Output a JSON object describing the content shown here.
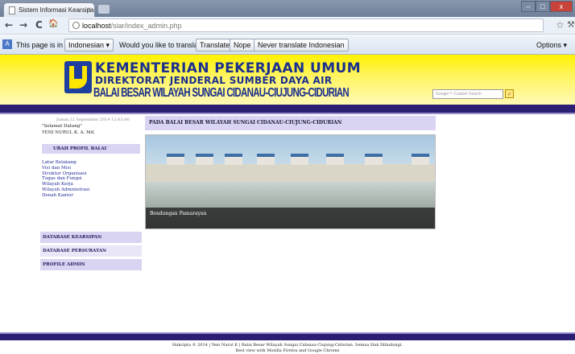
{
  "browser": {
    "tab_title": "Sistem Informasi Kearsipan",
    "tab_close": "×",
    "url_host": "localhost",
    "url_path": "/siar/index_admin.php",
    "back": "←",
    "forward": "→",
    "reload": "C",
    "home": "🏠",
    "star": "☆",
    "wrench": "⚒",
    "window_minimize": "–",
    "window_maximize": "□",
    "window_close": "x"
  },
  "translate_bar": {
    "prefix": "This page is in",
    "language": "Indonesian ▾",
    "question": "Would you like to translate it?",
    "translate": "Translate",
    "nope": "Nope",
    "never": "Never translate Indonesian",
    "options": "Options ▾"
  },
  "banner": {
    "line1": "KEMENTERIAN PEKERJAAN UMUM",
    "line2": "DIREKTORAT JENDERAL SUMBER DAYA AIR",
    "line3": "BALAI BESAR WILAYAH SUNGAI CIDANAU-CIUJUNG-CIDURIAN",
    "search_placeholder": "Google™ Custom Search",
    "search_icon": "search-icon"
  },
  "sidebar": {
    "date": "Jumat,12 September 2014 12:03:06",
    "greeting": "\"Selamat Datang\"",
    "user": "YENI NURUL K. A. Md.",
    "profile_button": "UBAH PROFIL BALAI",
    "menu": [
      "Latar Belakang",
      "Visi dan Misi",
      "Struktur Organisasi",
      "Tugas dan Fungsi",
      "Wilayah Kerja",
      "Wilayah Administrasi",
      "Denah Kantor"
    ],
    "database_kearsipan": "DATABASE KEARSIPAN",
    "database_persuratan": "DATABASE PERSURATAN",
    "profile_admin": "PROFILE ADMIN"
  },
  "main": {
    "heading": "PADA BALAI BESAR WILAYAH SUNGAI CIDANAU-CIUJUNG-CIDURIAN",
    "caption": "Bendungan Pamarayan"
  },
  "footer": {
    "line1": "Hakcipta © 2014 | Yeni Nurul K | Balai Besar Wilayah Sungai Cidanau-Ciujung-Cidurian. Semua Hak Dilindungi.",
    "line2": "Best view with Mozilla Firefox and Google Chrome"
  }
}
